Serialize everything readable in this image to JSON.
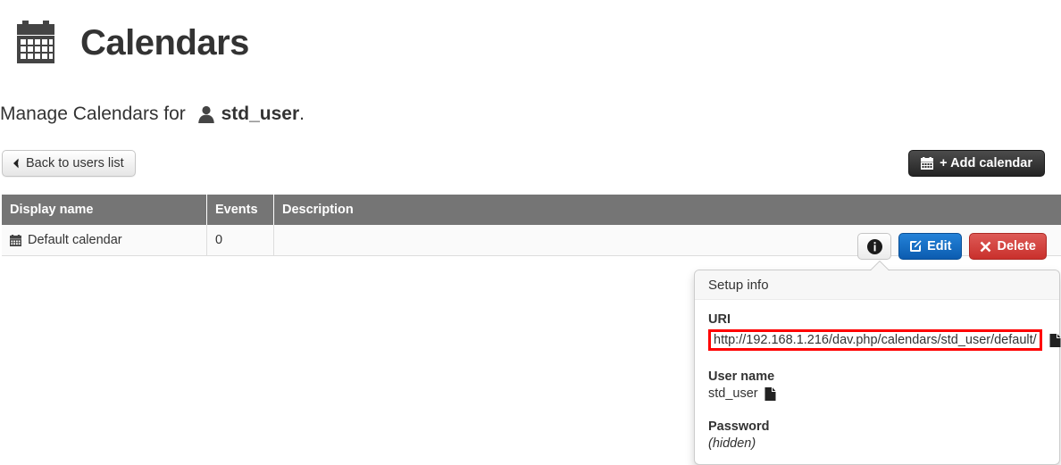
{
  "header": {
    "title": "Calendars",
    "icon": "calendar-icon"
  },
  "subtitle": {
    "prefix": "Manage Calendars for ",
    "user_icon": "user-icon",
    "username": "std_user",
    "suffix": "."
  },
  "toolbar": {
    "back_label": "Back to users list",
    "back_icon": "chevron-left-icon",
    "add_label": "+ Add calendar",
    "add_icon": "calendar-icon"
  },
  "table": {
    "columns": [
      "Display name",
      "Events",
      "Description"
    ],
    "rows": [
      {
        "icon": "calendar-icon",
        "display_name": "Default calendar",
        "events": "0",
        "description": ""
      }
    ]
  },
  "actions": {
    "info_icon": "info-circle-icon",
    "edit_label": "Edit",
    "edit_icon": "pencil-square-icon",
    "delete_label": "Delete",
    "delete_icon": "close-x-icon"
  },
  "popover": {
    "title": "Setup info",
    "uri_label": "URI",
    "uri_value": "http://192.168.1.216/dav.php/calendars/std_user/default/",
    "uri_copy_icon": "copy-icon",
    "username_label": "User name",
    "username_value": "std_user",
    "username_copy_icon": "copy-icon",
    "password_label": "Password",
    "password_value": "(hidden)"
  },
  "colors": {
    "highlight": "#ff0000",
    "table_header": "#757575",
    "edit_blue": "#1a6fc4",
    "delete_red": "#c9302c",
    "dark_button": "#2f2f2f"
  }
}
